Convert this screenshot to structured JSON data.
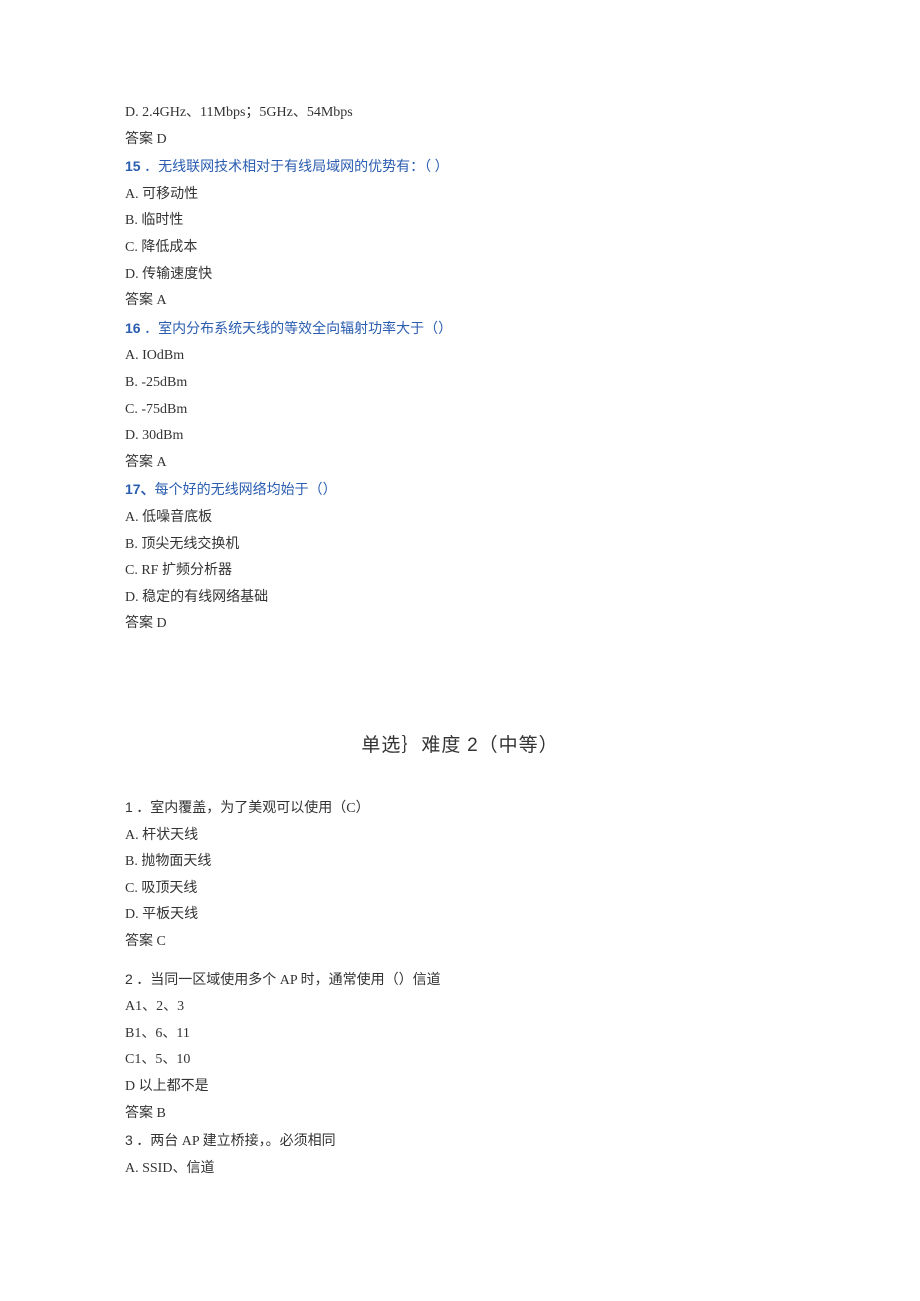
{
  "q14": {
    "optD": "D.  2.4GHz、11Mbps；5GHz、54Mbps",
    "answer": "答案 D"
  },
  "q15": {
    "num": "15",
    "stem": " ．无线联网技术相对于有线局域网的优势有：（      ）",
    "optA": "A. 可移动性",
    "optB": "B. 临时性",
    "optC": "C. 降低成本",
    "optD": "D. 传输速度快",
    "answer": "答案 A"
  },
  "q16": {
    "num": "16",
    "stem": " ．室内分布系统天线的等效全向辐射功率大于（）",
    "optA": "A.  IOdBm",
    "optB": "B.  -25dBm",
    "optC": "C.  -75dBm",
    "optD": "D.  30dBm",
    "answer": "答案 A"
  },
  "q17": {
    "num": "17、",
    "stem": "每个好的无线网络均始于（）",
    "optA": "A. 低噪音底板",
    "optB": "B. 顶尖无线交换机",
    "optC": "C. RF 扩频分析器",
    "optD": "D. 稳定的有线网络基础",
    "answer": "答案 D"
  },
  "section2": {
    "title_prefix": "单选｝难度 ",
    "title_num": "2",
    "title_suffix": "（中等）"
  },
  "s2q1": {
    "num": "1",
    "stem": "．室内覆盖，为了美观可以使用（C）",
    "optA": "A. 杆状天线",
    "optB": "B. 抛物面天线",
    "optC": "C. 吸顶天线",
    "optD": "D. 平板天线",
    "answer": "答案 C"
  },
  "s2q2": {
    "num": "2",
    "stem": "．当同一区域使用多个 AP 时，通常使用（）信道",
    "optA": "A1、2、3",
    "optB": "B1、6、11",
    "optC": "C1、5、10",
    "optD": "D 以上都不是",
    "answer": "答案 B"
  },
  "s2q3": {
    "num": "3",
    "stem": "．两台 AP 建立桥接，。必须相同",
    "optA": "A. SSID、信道"
  }
}
